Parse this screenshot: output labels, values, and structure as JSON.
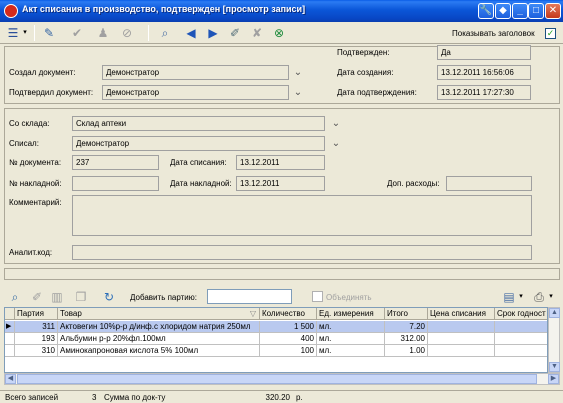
{
  "window": {
    "title": "Акт списания  в производство, подтвержден [просмотр записи]",
    "buttons": {
      "tools": "🔧",
      "restore_down": "◆",
      "minimize": "_",
      "maximize": "□",
      "close": "✕"
    }
  },
  "toolbar": {
    "show_header_label": "Показывать заголовок",
    "show_header_checked": true
  },
  "header": {
    "created_by_label": "Создал документ:",
    "created_by_value": "Демонстратор",
    "confirmed_by_label": "Подтвердил документ:",
    "confirmed_by_value": "Демонстратор",
    "confirmed_label": "Подтвержден:",
    "confirmed_value": "Да",
    "created_date_label": "Дата создания:",
    "created_date_value": "13.12.2011 16:56:06",
    "confirm_date_label": "Дата подтверждения:",
    "confirm_date_value": "13.12.2011 17:27:30"
  },
  "details": {
    "warehouse_label": "Со склада:",
    "warehouse_value": "Склад аптеки",
    "written_off_by_label": "Списал:",
    "written_off_by_value": "Демонстратор",
    "doc_number_label": "№ документа:",
    "doc_number_value": "237",
    "writeoff_date_label": "Дата списания:",
    "writeoff_date_value": "13.12.2011",
    "invoice_number_label": "№ накладной:",
    "invoice_number_value": "",
    "invoice_date_label": "Дата накладной:",
    "invoice_date_value": "13.12.2011",
    "extra_expenses_label": "Доп. расходы:",
    "extra_expenses_value": "",
    "comment_label": "Комментарий:",
    "comment_value": "",
    "analytic_code_label": "Аналит.код:",
    "analytic_code_value": ""
  },
  "grid_toolbar": {
    "add_batch_label": "Добавить партию:",
    "add_batch_value": "",
    "merge_label": "Объединять",
    "merge_checked": false
  },
  "table": {
    "columns": [
      "Партия",
      "Товар",
      "Количество",
      "Ед. измерения",
      "Итого",
      "Цена списания",
      "Срок годност"
    ],
    "sort_indicator": "▽",
    "rows": [
      {
        "batch": "311",
        "product": "Актовегин 10%р-р д/инф.с хлоридом натрия 250мл",
        "qty": "1 500",
        "unit": "мл.",
        "total": "7.20",
        "price": "",
        "expiry": ""
      },
      {
        "batch": "193",
        "product": "Альбумин р-р 20%фл.100мл",
        "qty": "400",
        "unit": "мл.",
        "total": "312.00",
        "price": "",
        "expiry": ""
      },
      {
        "batch": "310",
        "product": "Аминокапроновая кислота 5% 100мл",
        "qty": "100",
        "unit": "мл.",
        "total": "1.00",
        "price": "",
        "expiry": ""
      }
    ],
    "selected_row": 0
  },
  "status": {
    "records_label": "Всего записей",
    "records_value": "3",
    "sum_label": "Сумма по док-ту",
    "sum_value": "320.20",
    "sum_unit": "р."
  },
  "colors": {
    "title_bar": "#0a5ce6",
    "face": "#ece9d8",
    "selection": "#b9c9ef",
    "border": "#7f9db9"
  }
}
